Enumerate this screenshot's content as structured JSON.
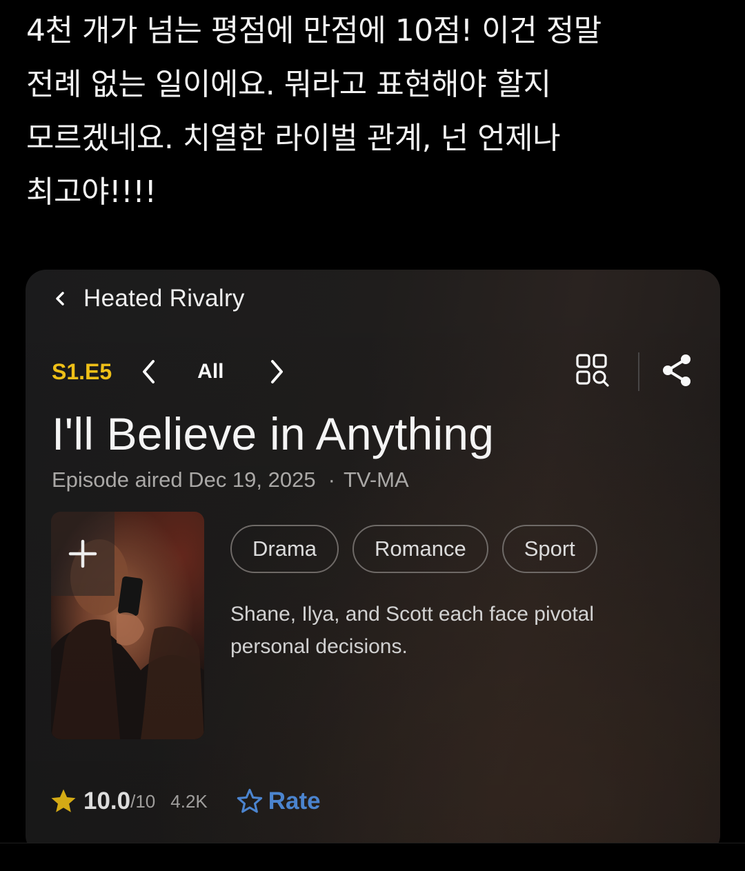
{
  "post": {
    "text": "4천 개가 넘는 평점에 만점에 10점! 이건 정말\n전례 없는 일이에요. 뭐라고 표현해야 할지\n모르겠네요. 치열한 라이벌 관계, 넌 언제나\n최고야!!!!"
  },
  "card": {
    "back_icon": "chevron-left-icon",
    "show_title": "Heated Rivalry",
    "episode_code": "S1.E5",
    "prev_icon": "chevron-left-icon",
    "all_label": "All",
    "next_icon": "chevron-right-icon",
    "grid_search_icon": "grid-search-icon",
    "share_icon": "share-icon",
    "episode_title": "I'll Believe in Anything",
    "aired_text": "Episode aired Dec 19, 2025",
    "separator": "·",
    "content_rating": "TV-MA",
    "add_icon": "plus-icon",
    "genres": [
      "Drama",
      "Romance",
      "Sport"
    ],
    "description": "Shane, Ilya, and Scott each face pivotal personal decisions.",
    "rating": {
      "star_icon": "star-filled-icon",
      "score": "10.0",
      "scale": "/10",
      "count": "4.2K",
      "rate_icon": "star-outline-icon",
      "rate_label": "Rate"
    }
  },
  "colors": {
    "accent_gold": "#f5c518",
    "link_blue": "#5799ef",
    "background": "#000000"
  }
}
